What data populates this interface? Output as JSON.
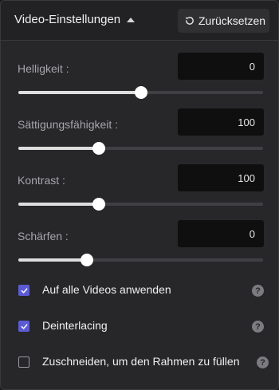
{
  "header": {
    "title": "Video-Einstellungen",
    "reset_label": "Zurücksetzen"
  },
  "sliders": [
    {
      "label": "Helligkeit :",
      "value": "0",
      "level": 0.5
    },
    {
      "label": "Sättigungsfähigkeit :",
      "value": "100",
      "level": 0.33
    },
    {
      "label": "Kontrast :",
      "value": "100",
      "level": 0.33
    },
    {
      "label": "Schärfen :",
      "value": "0",
      "level": 0.28
    }
  ],
  "options": [
    {
      "label": "Auf alle Videos anwenden",
      "checked": true
    },
    {
      "label": "Deinterlacing",
      "checked": true
    },
    {
      "label": "Zuschneiden, um den Rahmen zu füllen",
      "checked": false
    }
  ],
  "help_glyph": "?",
  "colors": {
    "accent": "#5b5bd6",
    "panel": "#27272a",
    "input_bg": "#0f0f10"
  }
}
